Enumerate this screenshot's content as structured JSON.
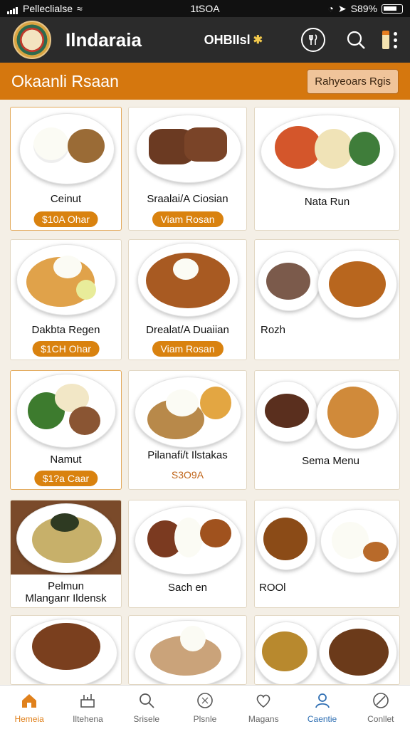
{
  "status_bar": {
    "carrier": "Pelleclialse",
    "time": "1tSOA",
    "battery": "S89%"
  },
  "app_bar": {
    "title": "Ilndaraia",
    "language_label": "OHBIIsl"
  },
  "category_bar": {
    "title": "Okaanli Rsaan",
    "filter_label": "Rahyeoars  Rgis"
  },
  "menu": [
    {
      "name": "Ceinut",
      "price": "$10A Ohar"
    },
    {
      "name": "Sraalai/A Ciosian",
      "price": "Viam Rosan"
    },
    {
      "name": "Nata Run"
    },
    {
      "name": "Dakbta Regen",
      "price": "$1CH Ohar"
    },
    {
      "name": "Drealat/A Duaiian",
      "price": "Viam Rosan"
    },
    {
      "name": "Rozh"
    },
    {
      "name": "Namut",
      "price": "$1?a Caar"
    },
    {
      "name": "Pilanafi/t Ilstakas",
      "price": "S3O9A"
    },
    {
      "name": "Sema Menu"
    },
    {
      "name": "Pelmun\nMlanganr Ildensk"
    },
    {
      "name": "Sach en"
    },
    {
      "name": "ROOl"
    }
  ],
  "bottom_nav": [
    {
      "label": "Hemeia",
      "icon": "home-icon"
    },
    {
      "label": "Iltehena",
      "icon": "kitchen-icon"
    },
    {
      "label": "Srisele",
      "icon": "search-icon"
    },
    {
      "label": "Plsnle",
      "icon": "plate-icon"
    },
    {
      "label": "Magans",
      "icon": "heart-icon"
    },
    {
      "label": "Caentie",
      "icon": "profile-icon"
    },
    {
      "label": "Conllet",
      "icon": "compass-icon"
    }
  ],
  "colors": {
    "accent": "#d5770e",
    "appbar": "#2b2b2b",
    "background": "#f4efe6"
  }
}
